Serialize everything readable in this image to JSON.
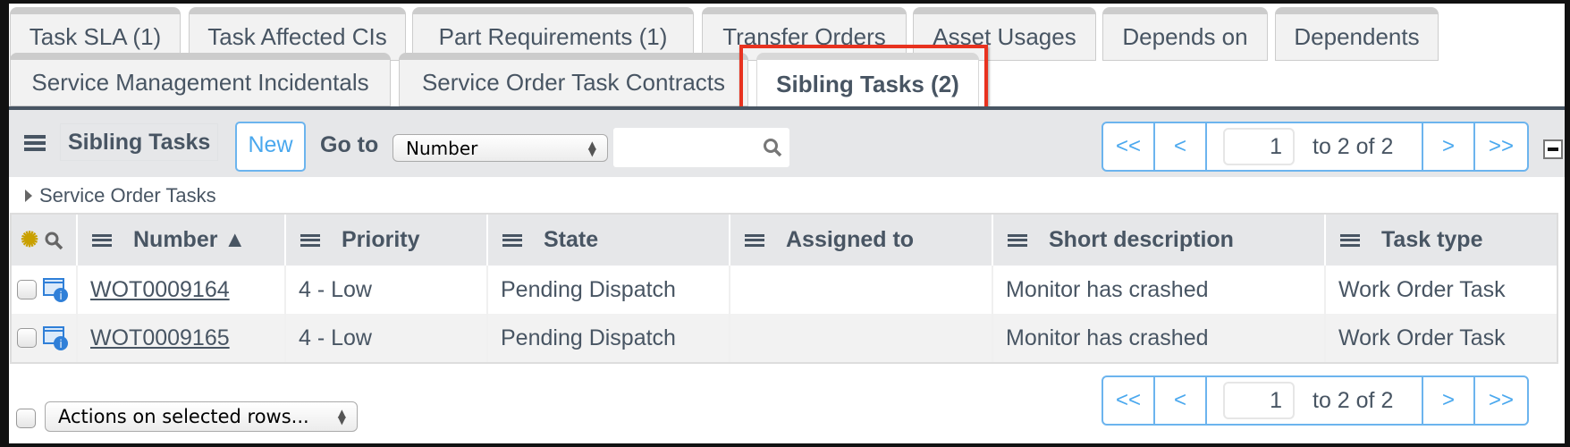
{
  "tabs_row1": [
    {
      "label": "Task SLA (1)"
    },
    {
      "label": "Task Affected CIs"
    },
    {
      "label": "Part Requirements (1)"
    },
    {
      "label": "Transfer Orders"
    },
    {
      "label": "Asset Usages"
    },
    {
      "label": "Depends on"
    },
    {
      "label": "Dependents"
    }
  ],
  "tabs_row2": [
    {
      "label": "Service Management Incidentals"
    },
    {
      "label": "Service Order Task Contracts"
    },
    {
      "label": "Sibling Tasks (2)",
      "selected": true
    }
  ],
  "toolbar": {
    "title": "Sibling Tasks",
    "new_label": "New",
    "goto_label": "Go to",
    "goto_select": "Number",
    "search_value": ""
  },
  "pager": {
    "first": "<<",
    "prev": "<",
    "page": "1",
    "range": "to 2 of 2",
    "next": ">",
    "last": ">>"
  },
  "breadcrumb": "Service Order Tasks",
  "table": {
    "columns": [
      {
        "label": "Number ▲"
      },
      {
        "label": "Priority"
      },
      {
        "label": "State"
      },
      {
        "label": "Assigned to"
      },
      {
        "label": "Short description"
      },
      {
        "label": "Task type"
      }
    ],
    "rows": [
      {
        "number": "WOT0009164",
        "priority": "4 - Low",
        "state": "Pending Dispatch",
        "assigned_to": "",
        "short_description": "Monitor has crashed",
        "task_type": "Work Order Task"
      },
      {
        "number": "WOT0009165",
        "priority": "4 - Low",
        "state": "Pending Dispatch",
        "assigned_to": "",
        "short_description": "Monitor has crashed",
        "task_type": "Work Order Task"
      }
    ]
  },
  "footer": {
    "actions_select": "Actions on selected rows..."
  },
  "colors": {
    "accent": "#4aa8ee",
    "highlight": "#e8321f",
    "text": "#485563"
  }
}
